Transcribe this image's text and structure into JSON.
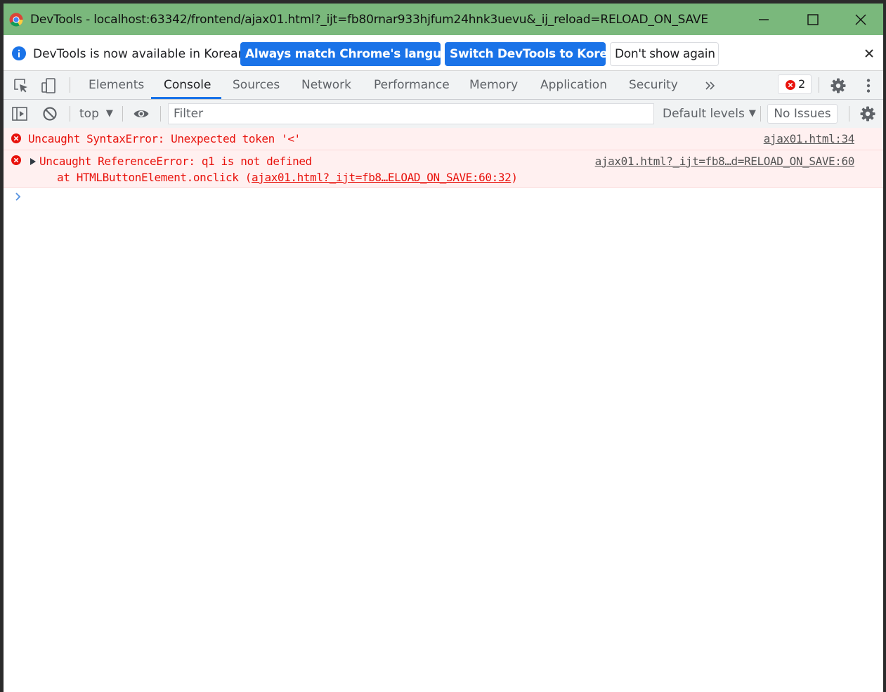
{
  "window": {
    "title": "DevTools - localhost:63342/frontend/ajax01.html?_ijt=fb80rnar933hjfum24hnk3uevu&_ij_reload=RELOAD_ON_SAVE"
  },
  "infobar": {
    "message": "DevTools is now available in Korean!",
    "btn_match": "Always match Chrome's language",
    "btn_switch": "Switch DevTools to Korean",
    "btn_dont": "Don't show again"
  },
  "tabs": [
    {
      "label": "Elements"
    },
    {
      "label": "Console"
    },
    {
      "label": "Sources"
    },
    {
      "label": "Network"
    },
    {
      "label": "Performance"
    },
    {
      "label": "Memory"
    },
    {
      "label": "Application"
    },
    {
      "label": "Security"
    }
  ],
  "active_tab": "Console",
  "error_count": "2",
  "console_toolbar": {
    "context": "top",
    "filter_placeholder": "Filter",
    "levels": "Default levels",
    "issues": "No Issues"
  },
  "messages": [
    {
      "text": "Uncaught SyntaxError: Unexpected token '<'",
      "source": "ajax01.html:34"
    },
    {
      "text": "Uncaught ReferenceError: q1 is not defined",
      "stack_prefix": "at HTMLButtonElement.onclick (",
      "stack_link": "ajax01.html?_ijt=fb8…ELOAD_ON_SAVE:60:32",
      "stack_suffix": ")",
      "source": "ajax01.html?_ijt=fb8…d=RELOAD_ON_SAVE:60"
    }
  ],
  "colors": {
    "titlebar": "#7ab87c",
    "accent": "#1a73e8",
    "error_text": "#e8120c",
    "error_bg": "#fff0f0"
  }
}
